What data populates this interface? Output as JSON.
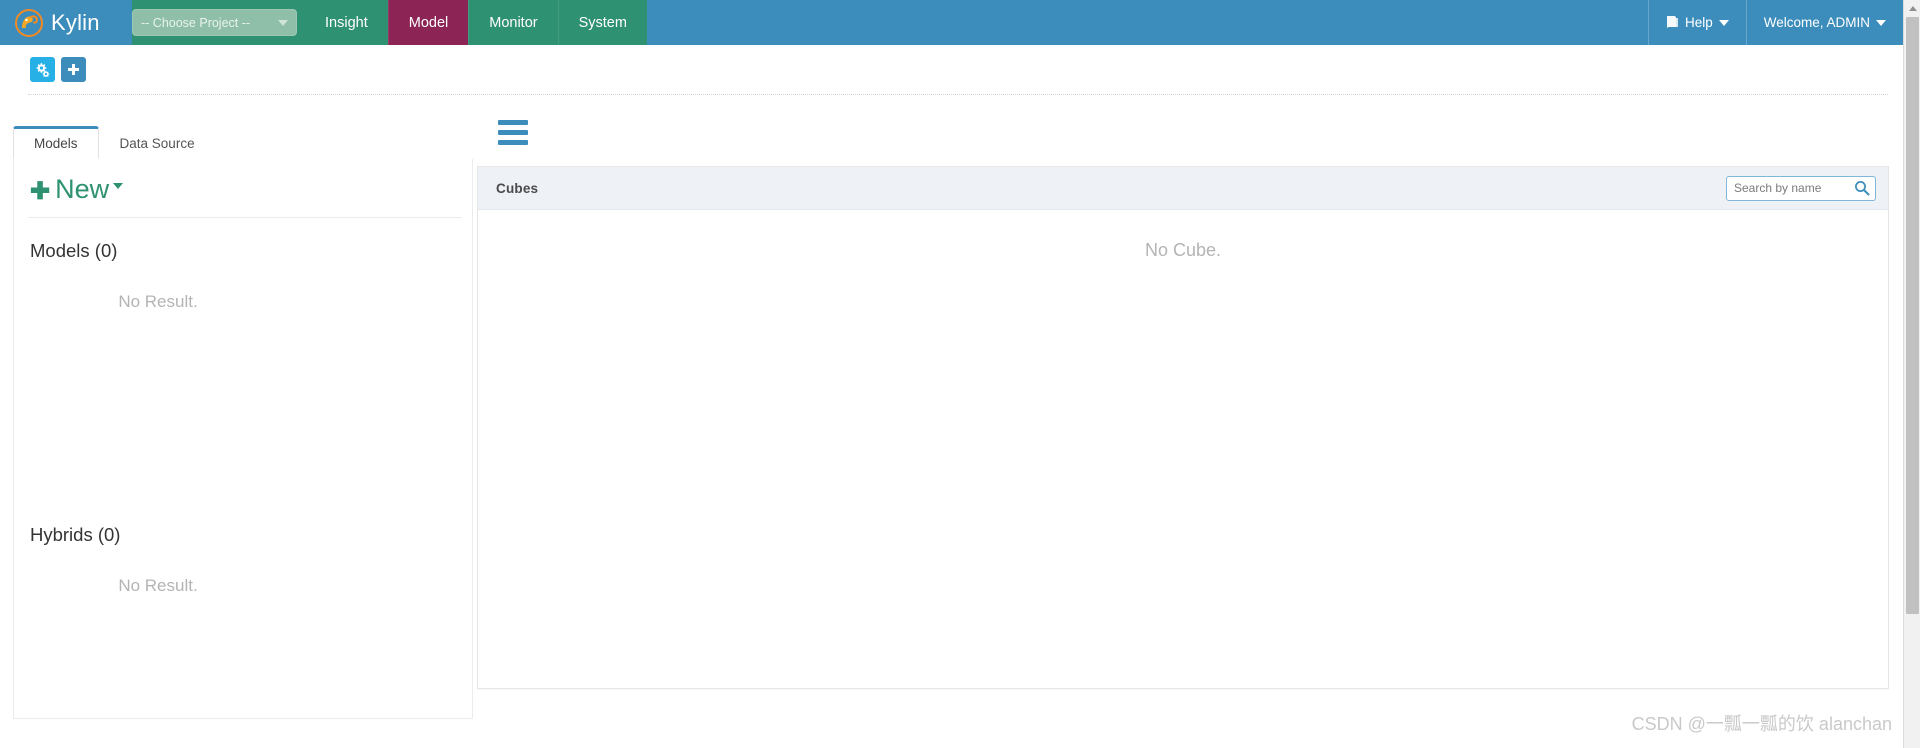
{
  "navbar": {
    "brand": "Kylin",
    "logo_icon": "kylin-parrot-logo",
    "project_select": {
      "value": "-- Choose Project --",
      "caret_icon": "caret-down-icon"
    },
    "items": [
      {
        "label": "Insight",
        "active": false
      },
      {
        "label": "Model",
        "active": true
      },
      {
        "label": "Monitor",
        "active": false
      },
      {
        "label": "System",
        "active": false
      }
    ],
    "right": {
      "help_label": "Help",
      "help_icon": "book-icon",
      "help_caret_icon": "caret-down-icon",
      "user_label": "Welcome, ADMIN",
      "user_caret_icon": "caret-down-icon"
    },
    "colors": {
      "brand_blue": "#3c8dbc",
      "nav_green": "#2e9171",
      "active_maroon": "#8c2556"
    }
  },
  "toolbar": {
    "buttons": [
      {
        "name": "manage-projects",
        "icon": "cogs-icon",
        "color": "#26b0e6"
      },
      {
        "name": "add-project",
        "icon": "plus-icon",
        "color": "#3c8dbc"
      }
    ]
  },
  "tabs": [
    {
      "label": "Models",
      "active": true
    },
    {
      "label": "Data Source",
      "active": false
    }
  ],
  "left_panel": {
    "new_button": {
      "label": "New",
      "plus_icon": "plus-icon",
      "caret_icon": "caret-down-icon",
      "color": "#2e9171"
    },
    "sections": [
      {
        "title": "Models (0)",
        "empty_text": "No Result."
      },
      {
        "title": "Hybrids (0)",
        "empty_text": "No Result."
      }
    ]
  },
  "right_panel": {
    "menu_toggle_icon": "hamburger-icon",
    "panel_title": "Cubes",
    "search": {
      "placeholder": "Search by name",
      "value": "",
      "icon": "search-icon"
    },
    "empty_text": "No Cube."
  },
  "scrollbar": {
    "up_arrow_icon": "triangle-up-icon",
    "visible": true
  },
  "watermark": {
    "text": "CSDN @一瓢一瓢的饮 alanchan"
  }
}
